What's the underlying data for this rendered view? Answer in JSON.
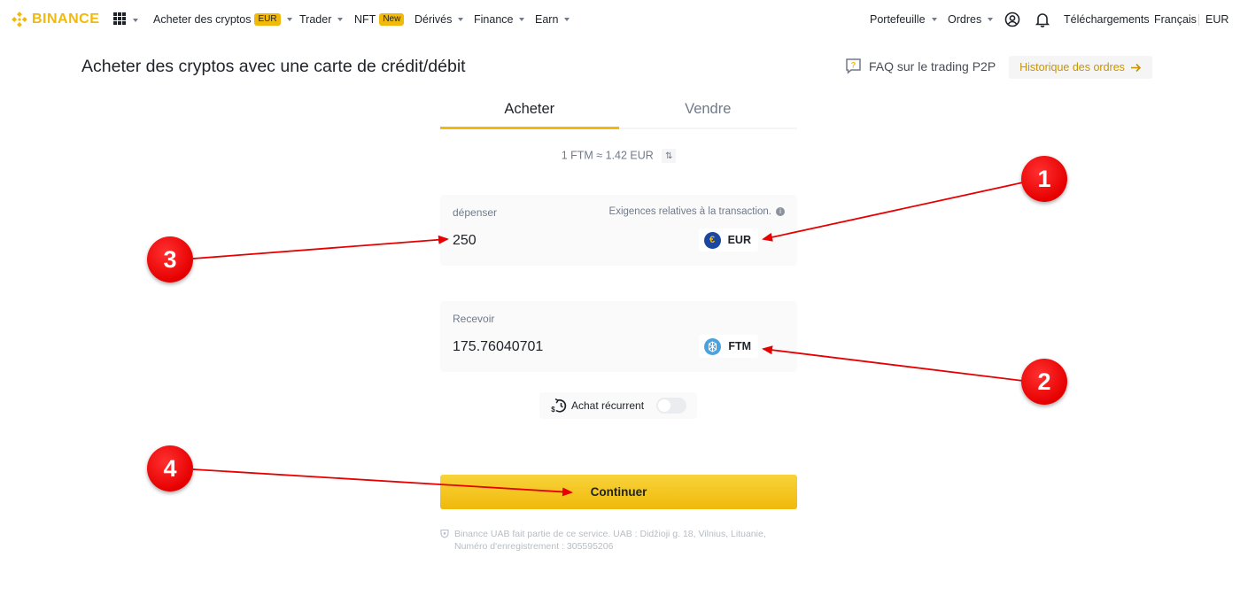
{
  "nav": {
    "brand": "BINANCE",
    "items": [
      {
        "label": "Acheter des cryptos",
        "badge": "EUR"
      },
      {
        "label": "Trader"
      },
      {
        "label": "NFT",
        "badge": "New"
      },
      {
        "label": "Dérivés"
      },
      {
        "label": "Finance"
      },
      {
        "label": "Earn"
      }
    ],
    "right": {
      "wallet": "Portefeuille",
      "orders": "Ordres",
      "downloads": "Téléchargements",
      "language": "Français",
      "currency": "EUR"
    }
  },
  "header": {
    "title": "Acheter des cryptos avec une carte de crédit/débit",
    "faq": "FAQ sur le trading P2P",
    "history": "Historique des ordres"
  },
  "tabs": [
    {
      "label": "Acheter",
      "active": true
    },
    {
      "label": "Vendre",
      "active": false
    }
  ],
  "rate": "1 FTM ≈ 1.42 EUR",
  "spend": {
    "label": "dépenser",
    "requirements": "Exigences relatives à la transaction.",
    "value": "250",
    "currency": "EUR",
    "currency_symbol": "€"
  },
  "receive": {
    "label": "Recevoir",
    "value": "175.76040701",
    "currency": "FTM"
  },
  "recurring": {
    "label": "Achat récurrent",
    "enabled": false
  },
  "continue": "Continuer",
  "legal": "Binance UAB fait partie de ce service. UAB : Didžioji g. 18, Vilnius, Lituanie, Numéro d'enregistrement : 305595206",
  "annotations": [
    {
      "number": "1",
      "target": "spend-currency"
    },
    {
      "number": "2",
      "target": "receive-currency"
    },
    {
      "number": "3",
      "target": "spend-amount"
    },
    {
      "number": "4",
      "target": "continue-button"
    }
  ],
  "colors": {
    "brand": "#F0B90B",
    "annotation": "#E60000"
  }
}
